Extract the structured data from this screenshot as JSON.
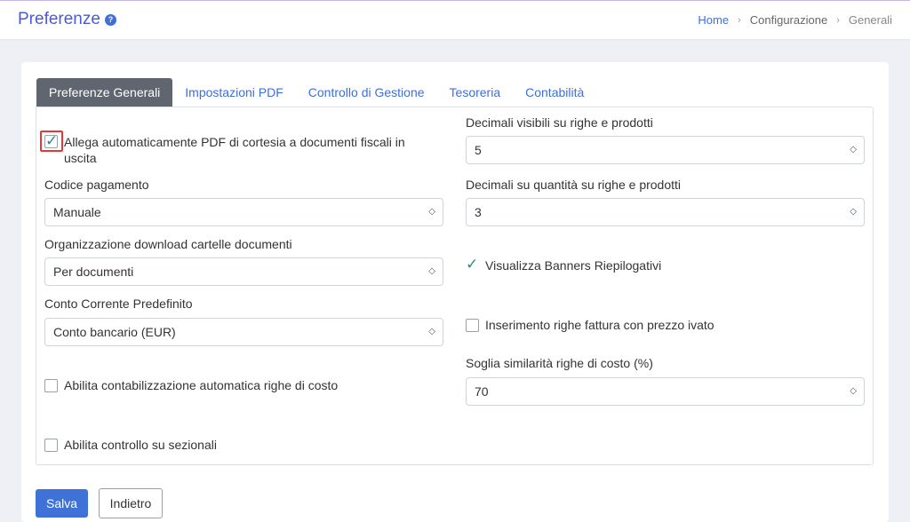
{
  "header": {
    "title": "Preferenze",
    "help_icon": "?",
    "breadcrumb": [
      "Home",
      "Configurazione",
      "Generali"
    ],
    "breadcrumb_separator": "›"
  },
  "tabs": [
    {
      "label": "Preferenze Generali",
      "active": true
    },
    {
      "label": "Impostazioni PDF",
      "active": false
    },
    {
      "label": "Controllo di Gestione",
      "active": false
    },
    {
      "label": "Tesoreria",
      "active": false
    },
    {
      "label": "Contabilità",
      "active": false
    }
  ],
  "left": {
    "pdf_checkbox": {
      "line1": "Allega automaticamente PDF di cortesia a documenti fiscali in",
      "line2": "uscita",
      "checked": true,
      "highlighted": true
    },
    "codice_pagamento": {
      "label": "Codice pagamento",
      "value": "Manuale"
    },
    "download": {
      "label": "Organizzazione download cartelle documenti",
      "value": "Per documenti"
    },
    "conto": {
      "label": "Conto Corrente Predefinito",
      "value": "Conto bancario (EUR)"
    },
    "contabilizzazione": {
      "label": "Abilita contabilizzazione automatica righe di costo",
      "checked": false
    },
    "sezionali": {
      "label": "Abilita controllo su sezionali",
      "checked": false
    }
  },
  "right": {
    "decimali_visibili": {
      "label": "Decimali visibili su righe e prodotti",
      "value": "5"
    },
    "decimali_quantita": {
      "label": "Decimali su quantità su righe e prodotti",
      "value": "3"
    },
    "banners": {
      "label": "Visualizza Banners Riepilogativi",
      "checked": true
    },
    "prezzo_ivato": {
      "label": "Inserimento righe fattura con prezzo ivato",
      "checked": false
    },
    "soglia": {
      "label": "Soglia similarità righe di costo (%)",
      "value": "70"
    }
  },
  "footer": {
    "save_label": "Salva",
    "back_label": "Indietro"
  },
  "symbols": {
    "check": "✓",
    "select_arrows": "◇"
  },
  "colors": {
    "accent": "#3f72d6",
    "title": "#4a5bd4",
    "check": "#2e8b88",
    "highlight": "#e53935",
    "active_tab": "#5f6670"
  }
}
